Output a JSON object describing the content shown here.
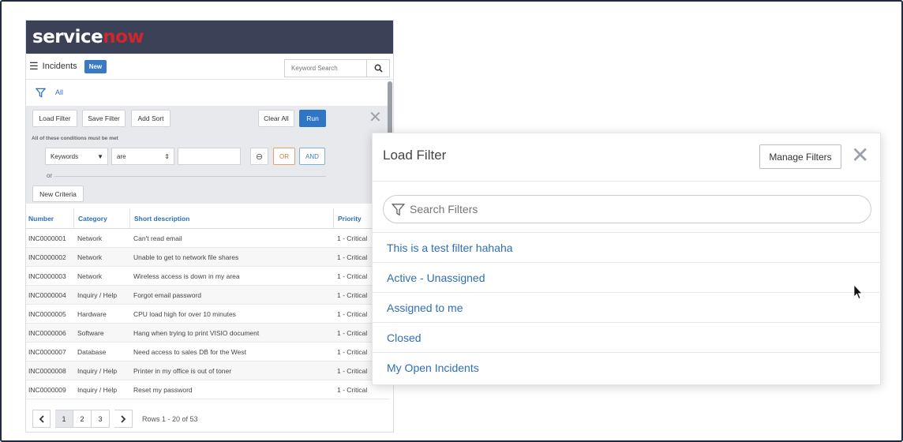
{
  "brand": {
    "logo_service": "service",
    "logo_now": "now"
  },
  "list": {
    "title": "Incidents",
    "new_label": "New",
    "search_placeholder": "Keyword Search",
    "breadcrumb_all": "All"
  },
  "filter_panel": {
    "load_filter": "Load Filter",
    "save_filter": "Save Filter",
    "add_sort": "Add Sort",
    "clear_all": "Clear All",
    "run": "Run",
    "conditions_label": "All of these conditions must be met",
    "field_value": "Keywords",
    "operator_value": "are",
    "or_label": "OR",
    "and_label": "AND",
    "or_separator": "or",
    "new_criteria": "New Criteria"
  },
  "table": {
    "columns": [
      "Number",
      "Category",
      "Short description",
      "Priority"
    ],
    "rows": [
      [
        "INC0000001",
        "Network",
        "Can't read email",
        "1 - Critical"
      ],
      [
        "INC0000002",
        "Network",
        "Unable to get to network file shares",
        "1 - Critical"
      ],
      [
        "INC0000003",
        "Network",
        "Wireless access is down in my area",
        "1 - Critical"
      ],
      [
        "INC0000004",
        "Inquiry / Help",
        "Forgot email password",
        "1 - Critical"
      ],
      [
        "INC0000005",
        "Hardware",
        "CPU load high for over 10 minutes",
        "1 - Critical"
      ],
      [
        "INC0000006",
        "Software",
        "Hang when trying to print VISIO document",
        "1 - Critical"
      ],
      [
        "INC0000007",
        "Database",
        "Need access to sales DB for the West",
        "1 - Critical"
      ],
      [
        "INC0000008",
        "Inquiry / Help",
        "Printer in my office is out of toner",
        "1 - Critical"
      ],
      [
        "INC0000009",
        "Inquiry / Help",
        "Reset my password",
        "1 - Critical"
      ]
    ]
  },
  "pager": {
    "pages": [
      "1",
      "2",
      "3"
    ],
    "rows_text": "Rows 1 - 20 of 53"
  },
  "modal": {
    "title": "Load Filter",
    "manage_label": "Manage Filters",
    "search_placeholder": "Search Filters",
    "filters": [
      "This is a test filter hahaha",
      "Active - Unassigned",
      "Assigned to me",
      "Closed",
      "My Open Incidents"
    ]
  },
  "icons": {
    "menu": "hamburger-icon",
    "search": "search-icon",
    "filter": "funnel-icon",
    "close": "close-icon",
    "prev": "chevron-left-icon",
    "next": "chevron-right-icon",
    "remove": "minus-circle-icon",
    "pointer": "mouse-pointer-icon"
  },
  "colors": {
    "banner": "#3b4156",
    "brand_red": "#d0262d",
    "link_blue": "#2e6fb5",
    "run_blue": "#2f76c5",
    "or_orange": "#e07a28"
  }
}
